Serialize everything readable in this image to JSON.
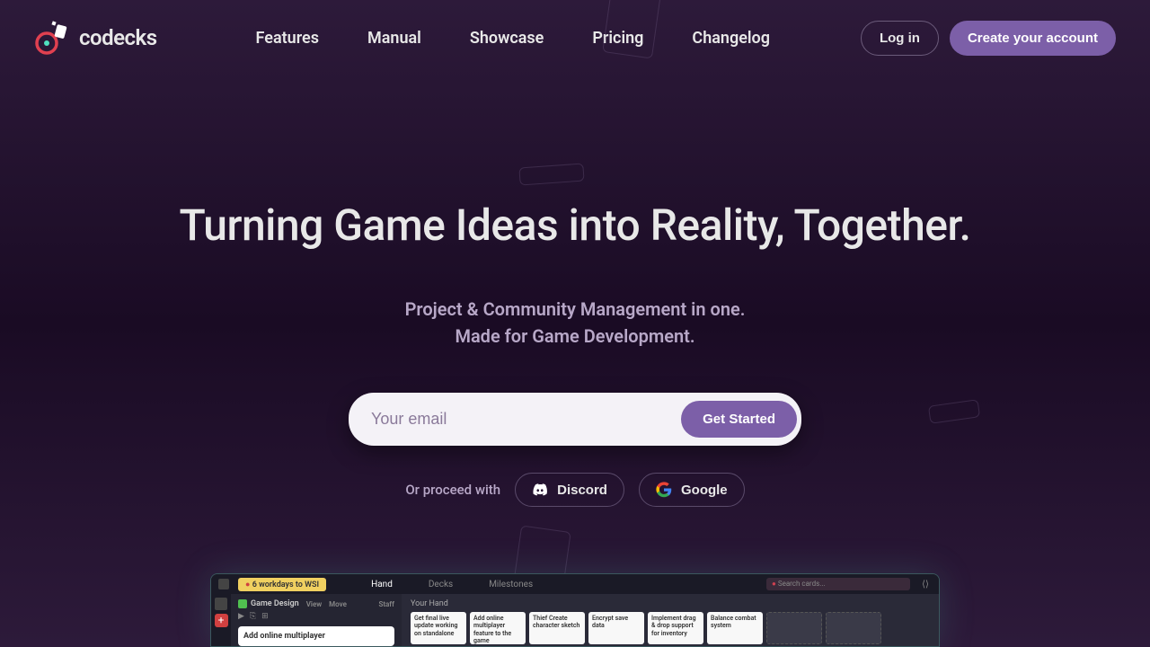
{
  "brand": "codecks",
  "nav": {
    "items": [
      "Features",
      "Manual",
      "Showcase",
      "Pricing",
      "Changelog"
    ]
  },
  "header": {
    "login": "Log in",
    "create": "Create your account"
  },
  "hero": {
    "title": "Turning Game Ideas into Reality, Together.",
    "sub1": "Project & Community Management in one.",
    "sub2": "Made for Game Development.",
    "email_placeholder": "Your email",
    "get_started": "Get Started",
    "proceed_text": "Or proceed with",
    "discord": "Discord",
    "google": "Google"
  },
  "preview": {
    "workdays": "6 workdays to WSI",
    "tabs": [
      "Hand",
      "Decks",
      "Milestones"
    ],
    "search_placeholder": "Search cards...",
    "section": "Game Design",
    "section_actions": [
      "View",
      "Move"
    ],
    "staff": "Staff",
    "edit_card": "Add online multiplayer",
    "hand_label": "Your Hand",
    "cards": [
      "Get final live update working on standalone",
      "Add online multiplayer feature to the game",
      "Thief Create character sketch",
      "Encrypt save data",
      "Implement drag & drop support for inventory",
      "Balance combat system"
    ]
  }
}
